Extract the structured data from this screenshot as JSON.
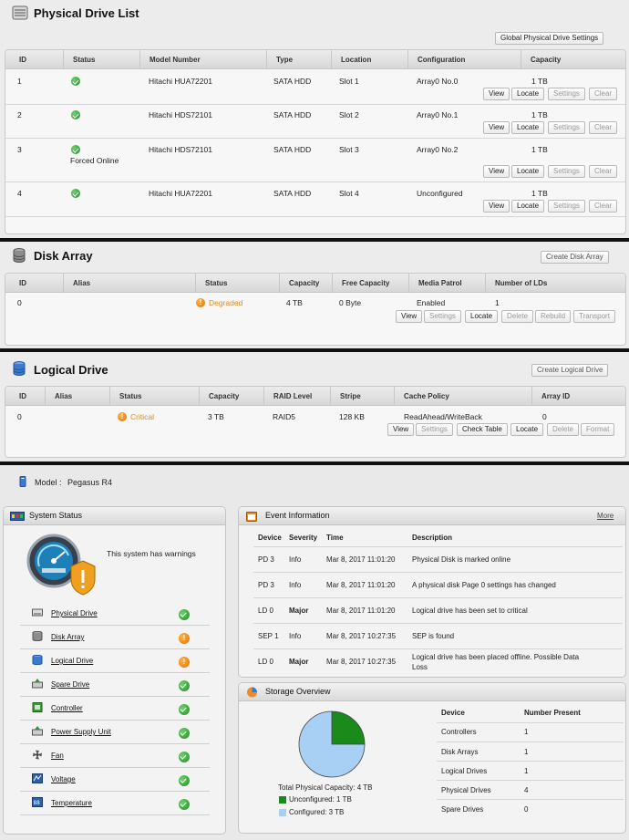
{
  "physical": {
    "title": "Physical Drive List",
    "settings_btn": "Global Physical Drive Settings",
    "headers": [
      "ID",
      "Status",
      "Model Number",
      "Type",
      "Location",
      "Configuration",
      "Capacity"
    ],
    "rows": [
      {
        "id": "1",
        "status": "",
        "model": "Hitachi HUA72201",
        "type": "SATA HDD",
        "location": "Slot 1",
        "config": "Array0 No.0",
        "capacity": "1 TB"
      },
      {
        "id": "2",
        "status": "",
        "model": "Hitachi HDS72101",
        "type": "SATA HDD",
        "location": "Slot 2",
        "config": "Array0 No.1",
        "capacity": "1 TB"
      },
      {
        "id": "3",
        "status": "Forced Online",
        "model": "Hitachi HDS72101",
        "type": "SATA HDD",
        "location": "Slot 3",
        "config": "Array0 No.2",
        "capacity": "1 TB"
      },
      {
        "id": "4",
        "status": "",
        "model": "Hitachi HUA72201",
        "type": "SATA HDD",
        "location": "Slot 4",
        "config": "Unconfigured",
        "capacity": "1 TB"
      }
    ],
    "buttons": [
      "View",
      "Locate",
      "Settings",
      "Clear"
    ]
  },
  "disk_array": {
    "title": "Disk Array",
    "create_btn": "Create Disk Array",
    "headers": [
      "ID",
      "Alias",
      "Status",
      "Capacity",
      "Free Capacity",
      "Media Patrol",
      "Number of LDs"
    ],
    "row": {
      "id": "0",
      "alias": "",
      "status": "Degraded",
      "capacity": "4 TB",
      "free": "0 Byte",
      "patrol": "Enabled",
      "lds": "1"
    },
    "buttons": [
      "View",
      "Settings",
      "Locate",
      "Delete",
      "Rebuild",
      "Transport"
    ]
  },
  "logical": {
    "title": "Logical Drive",
    "create_btn": "Create Logical Drive",
    "headers": [
      "ID",
      "Alias",
      "Status",
      "Capacity",
      "RAID Level",
      "Stripe",
      "Cache Policy",
      "Array ID"
    ],
    "row": {
      "id": "0",
      "alias": "",
      "status": "Critical",
      "capacity": "3 TB",
      "raid": "RAID5",
      "stripe": "128 KB",
      "cache": "ReadAhead/WriteBack",
      "array_id": "0"
    },
    "buttons": [
      "View",
      "Settings",
      "Check Table",
      "Locate",
      "Delete",
      "Format"
    ]
  },
  "dashboard": {
    "model_label": "Model :",
    "model_value": "Pegasus R4",
    "system_status": {
      "title": "System Status",
      "message": "This system has warnings",
      "items": [
        {
          "label": "Physical Drive",
          "state": "ok"
        },
        {
          "label": "Disk Array",
          "state": "warn"
        },
        {
          "label": "Logical Drive",
          "state": "warn"
        },
        {
          "label": "Spare Drive",
          "state": "ok"
        },
        {
          "label": "Controller",
          "state": "ok"
        },
        {
          "label": "Power Supply Unit",
          "state": "ok"
        },
        {
          "label": "Fan",
          "state": "ok"
        },
        {
          "label": "Voltage",
          "state": "ok"
        },
        {
          "label": "Temperature",
          "state": "ok"
        }
      ]
    },
    "events": {
      "title": "Event Information",
      "more": "More",
      "headers": [
        "Device",
        "Severity",
        "Time",
        "Description"
      ],
      "rows": [
        {
          "device": "PD 3",
          "severity": "Info",
          "time": "Mar 8, 2017 11:01:20",
          "desc": "Physical Disk is marked online",
          "desc2": ""
        },
        {
          "device": "PD 3",
          "severity": "Info",
          "time": "Mar 8, 2017 11:01:20",
          "desc": "A physical disk Page 0 settings has changed",
          "desc2": ""
        },
        {
          "device": "LD 0",
          "severity": "Major",
          "time": "Mar 8, 2017 11:01:20",
          "desc": "Logical drive has been set to critical",
          "desc2": ""
        },
        {
          "device": "SEP 1",
          "severity": "Info",
          "time": "Mar 8, 2017 10:27:35",
          "desc": "SEP is found",
          "desc2": ""
        },
        {
          "device": "LD 0",
          "severity": "Major",
          "time": "Mar 8, 2017 10:27:35",
          "desc": "Logical drive has been placed offline. Possible Data",
          "desc2": "Loss"
        }
      ]
    },
    "storage": {
      "title": "Storage Overview",
      "total_label": "Total Physical Capacity: 4 TB",
      "unconfigured_label": "Unconfigured: 1 TB",
      "configured_label": "Configured: 3 TB",
      "headers": [
        "Device",
        "Number Present"
      ],
      "rows": [
        {
          "device": "Controllers",
          "count": "1"
        },
        {
          "device": "Disk Arrays",
          "count": "1"
        },
        {
          "device": "Logical Drives",
          "count": "1"
        },
        {
          "device": "Physical Drives",
          "count": "4"
        },
        {
          "device": "Spare Drives",
          "count": "0"
        }
      ]
    }
  },
  "chart_data": {
    "type": "pie",
    "categories": [
      "Unconfigured",
      "Configured"
    ],
    "values": [
      1,
      3
    ],
    "colors": [
      "#1a8a1a",
      "#a8d0f5"
    ],
    "title": "Total Physical Capacity: 4 TB"
  },
  "colors": {
    "ok": "#1f8f1f",
    "warn": "#e07000",
    "major": "#d42020",
    "degraded": "#e08a1a"
  }
}
